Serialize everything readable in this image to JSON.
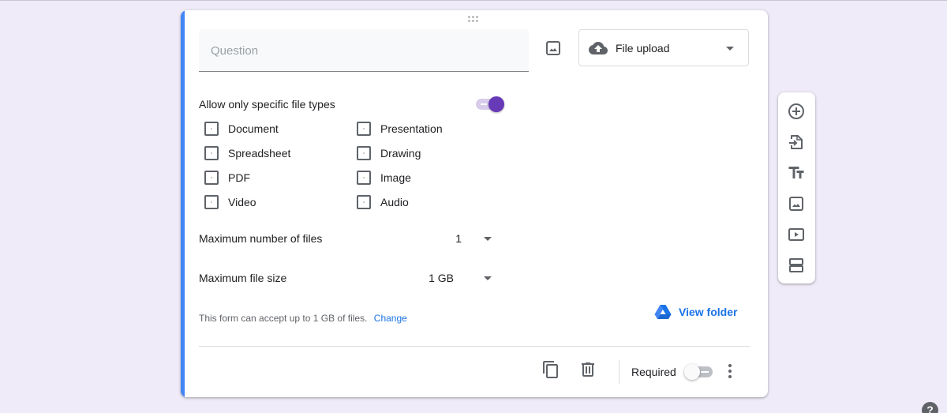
{
  "question": {
    "placeholder": "Question",
    "value": ""
  },
  "question_type": {
    "selected": "File upload",
    "icon": "cloud-upload-icon"
  },
  "file_types": {
    "label": "Allow only specific file types",
    "enabled": true,
    "options": [
      {
        "label": "Document",
        "checked": false
      },
      {
        "label": "Presentation",
        "checked": false
      },
      {
        "label": "Spreadsheet",
        "checked": false
      },
      {
        "label": "Drawing",
        "checked": false
      },
      {
        "label": "PDF",
        "checked": false
      },
      {
        "label": "Image",
        "checked": false
      },
      {
        "label": "Video",
        "checked": false
      },
      {
        "label": "Audio",
        "checked": false
      }
    ]
  },
  "max_files": {
    "label": "Maximum number of files",
    "value": "1"
  },
  "max_size": {
    "label": "Maximum file size",
    "value": "1 GB"
  },
  "info": {
    "text": "This form can accept up to 1 GB of files.",
    "link": "Change"
  },
  "view_folder": {
    "label": "View folder",
    "icon": "google-drive-icon"
  },
  "footer": {
    "required_label": "Required",
    "required": false
  },
  "side_toolbar": [
    {
      "name": "add-question",
      "icon": "add-circle-icon"
    },
    {
      "name": "import-questions",
      "icon": "import-icon"
    },
    {
      "name": "add-title-description",
      "icon": "title-icon"
    },
    {
      "name": "add-image",
      "icon": "image-icon"
    },
    {
      "name": "add-video",
      "icon": "video-icon"
    },
    {
      "name": "add-section",
      "icon": "section-icon"
    }
  ],
  "help": {
    "label": "?"
  },
  "colors": {
    "accent": "#4285f4",
    "toggle_on": "#673ab7",
    "link": "#1a73e8",
    "background": "#f0ebf8"
  }
}
